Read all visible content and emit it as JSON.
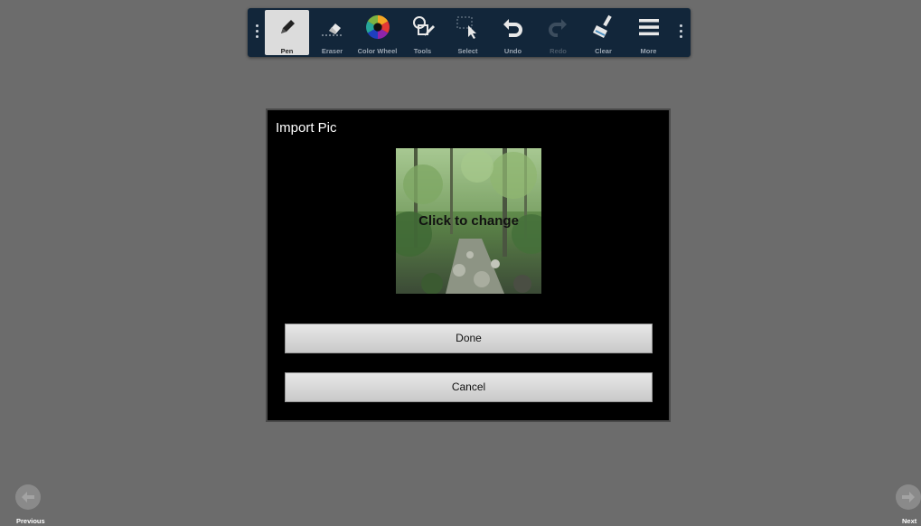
{
  "toolbar": {
    "tools": [
      {
        "label": "Pen",
        "icon": "pen-icon",
        "state": "active"
      },
      {
        "label": "Eraser",
        "icon": "eraser-icon",
        "state": "normal"
      },
      {
        "label": "Color Wheel",
        "icon": "color-wheel-icon",
        "state": "normal"
      },
      {
        "label": "Tools",
        "icon": "shapes-tool-icon",
        "state": "normal"
      },
      {
        "label": "Select",
        "icon": "select-icon",
        "state": "normal"
      },
      {
        "label": "Undo",
        "icon": "undo-icon",
        "state": "normal"
      },
      {
        "label": "Redo",
        "icon": "redo-icon",
        "state": "disabled"
      },
      {
        "label": "Clear",
        "icon": "clear-broom-icon",
        "state": "normal"
      },
      {
        "label": "More",
        "icon": "menu-icon",
        "state": "normal"
      }
    ]
  },
  "dialog": {
    "title": "Import Pic",
    "picture_caption": "Click to change",
    "done_label": "Done",
    "cancel_label": "Cancel"
  },
  "nav": {
    "previous_label": "Previous",
    "next_label": "Next"
  },
  "colors": {
    "canvas": "#6c6c6c",
    "toolbar_bg": "#12263a",
    "dialog_bg": "#000000"
  }
}
